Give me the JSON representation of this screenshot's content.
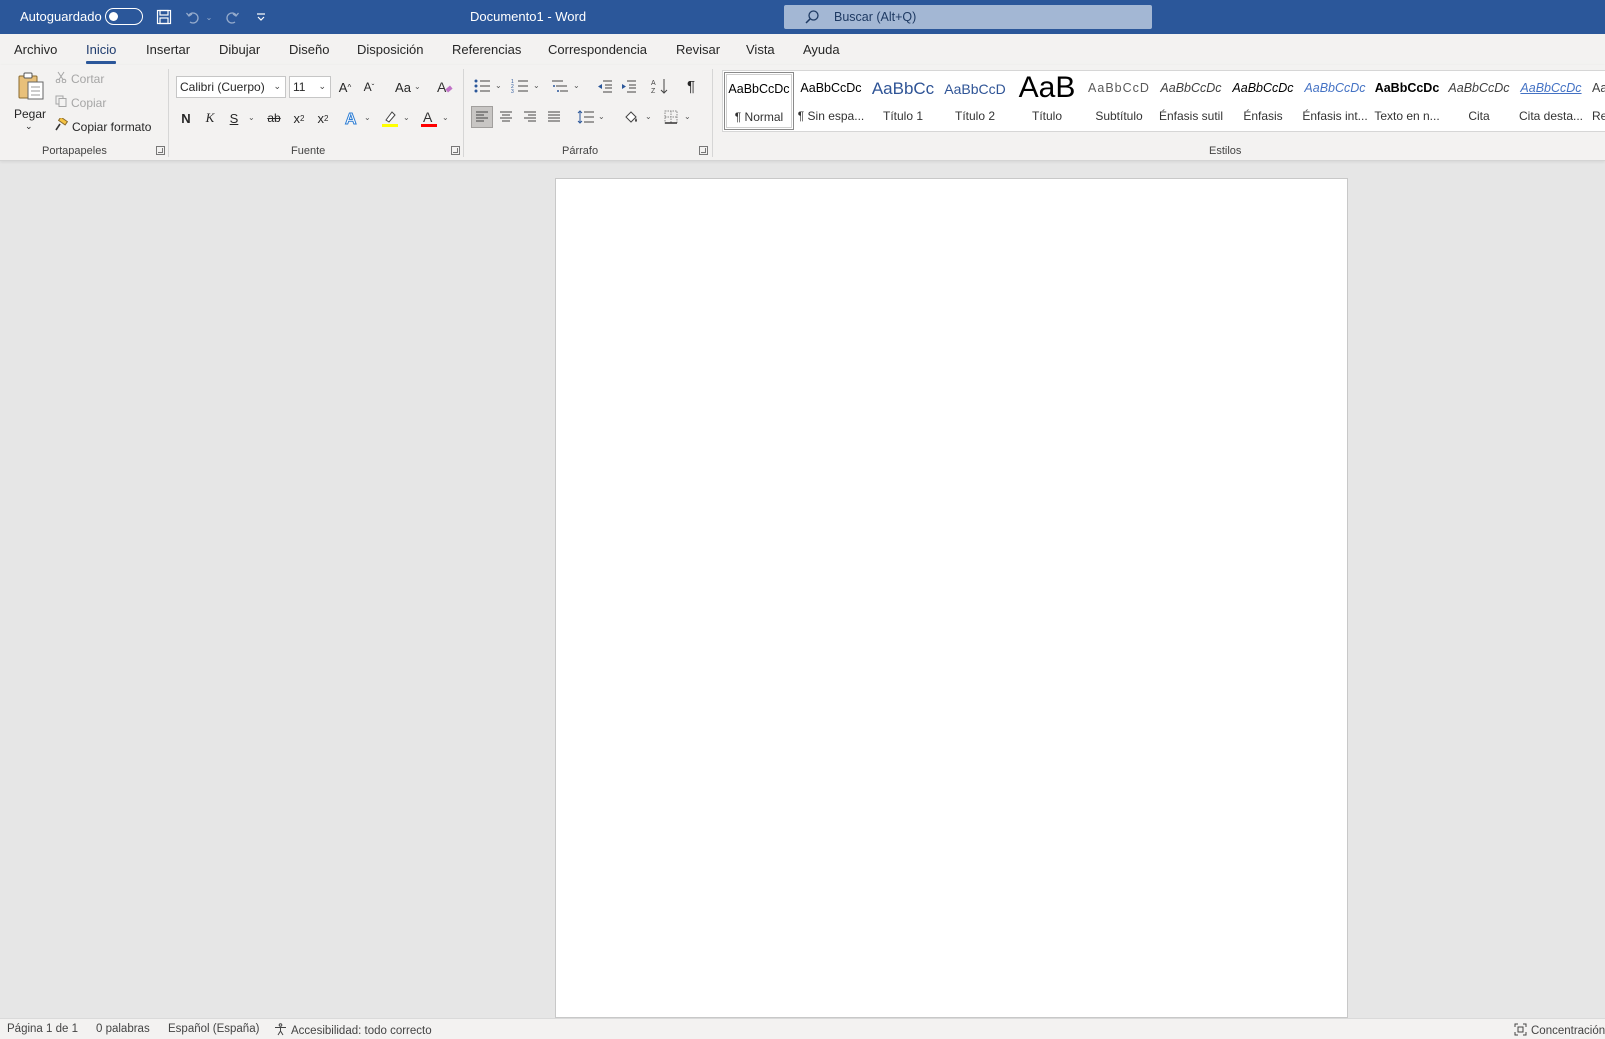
{
  "titlebar": {
    "autosave_label": "Autoguardado",
    "doc_title": "Documento1  -  Word",
    "search_placeholder": "Buscar (Alt+Q)"
  },
  "menu": {
    "tabs": [
      "Archivo",
      "Inicio",
      "Insertar",
      "Dibujar",
      "Diseño",
      "Disposición",
      "Referencias",
      "Correspondencia",
      "Revisar",
      "Vista",
      "Ayuda"
    ],
    "active_tab": "Inicio"
  },
  "clipboard": {
    "paste": "Pegar",
    "cut": "Cortar",
    "copy": "Copiar",
    "format_painter": "Copiar formato",
    "label": "Portapapeles"
  },
  "font": {
    "name": "Calibri (Cuerpo)",
    "size": "11",
    "label": "Fuente",
    "bold": "N",
    "italic": "K",
    "underline": "S",
    "strike": "ab",
    "case": "Aa"
  },
  "paragraph": {
    "label": "Párrafo"
  },
  "styles": {
    "label": "Estilos",
    "items": [
      {
        "sample": "AaBbCcDc",
        "name": "¶ Normal"
      },
      {
        "sample": "AaBbCcDc",
        "name": "¶ Sin espa..."
      },
      {
        "sample": "AaBbCc",
        "name": "Título 1"
      },
      {
        "sample": "AaBbCcD",
        "name": "Título 2"
      },
      {
        "sample": "AaB",
        "name": "Título"
      },
      {
        "sample": "AaBbCcD",
        "name": "Subtítulo"
      },
      {
        "sample": "AaBbCcDc",
        "name": "Énfasis sutil"
      },
      {
        "sample": "AaBbCcDc",
        "name": "Énfasis"
      },
      {
        "sample": "AaBbCcDc",
        "name": "Énfasis int..."
      },
      {
        "sample": "AaBbCcDc",
        "name": "Texto en n..."
      },
      {
        "sample": "AaBbCcDc",
        "name": "Cita"
      },
      {
        "sample": "AaBbCcDc",
        "name": "Cita desta..."
      },
      {
        "sample": "AaBbCcDc",
        "name": "Ref"
      }
    ]
  },
  "status": {
    "page": "Página 1 de 1",
    "words": "0 palabras",
    "language": "Español (España)",
    "accessibility": "Accesibilidad: todo correcto",
    "focus": "Concentración"
  },
  "colors": {
    "brand": "#2b579a",
    "highlight": "#ffff00",
    "font_color": "#ff0000",
    "heading": "#2f5496"
  }
}
